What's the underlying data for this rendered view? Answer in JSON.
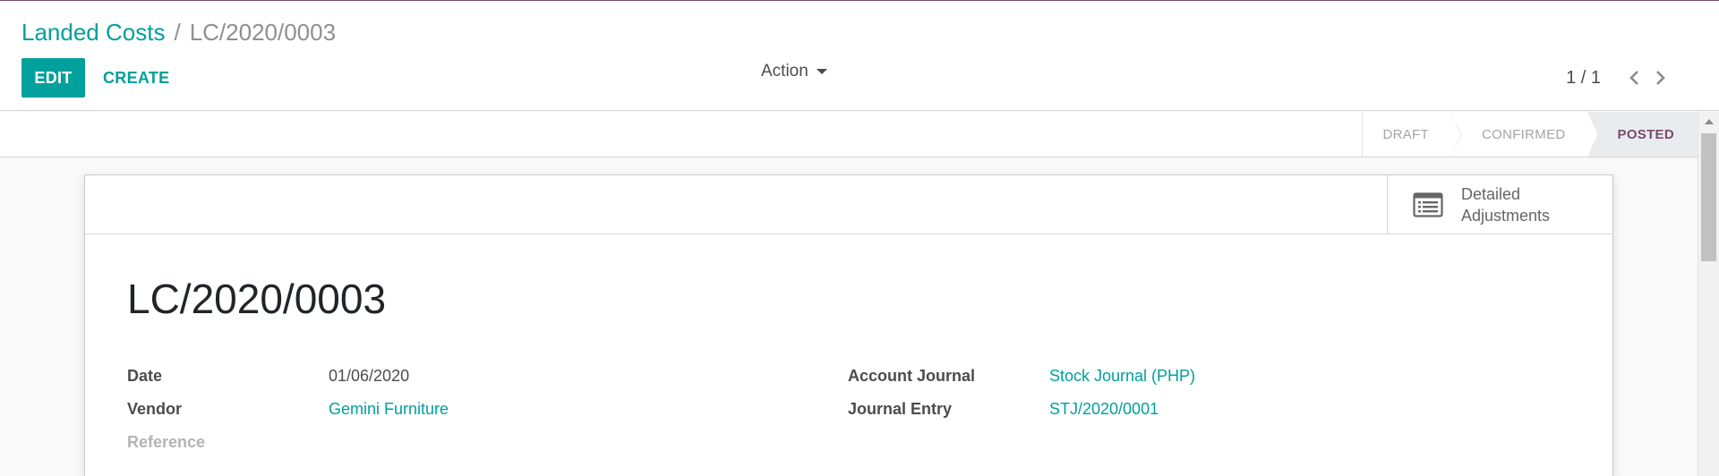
{
  "breadcrumb": {
    "parent": "Landed Costs",
    "separator": "/",
    "current": "LC/2020/0003"
  },
  "toolbar": {
    "edit_label": "EDIT",
    "create_label": "CREATE",
    "action_label": "Action"
  },
  "pager": {
    "value": "1 / 1"
  },
  "statusbar": {
    "stages": [
      {
        "label": "DRAFT",
        "active": false
      },
      {
        "label": "CONFIRMED",
        "active": false
      },
      {
        "label": "POSTED",
        "active": true
      }
    ]
  },
  "smart_button": {
    "line1": "Detailed",
    "line2": "Adjustments",
    "icon": "list-icon"
  },
  "record": {
    "title": "LC/2020/0003"
  },
  "fields": {
    "date": {
      "label": "Date",
      "value": "01/06/2020"
    },
    "vendor": {
      "label": "Vendor",
      "value": "Gemini Furniture"
    },
    "reference": {
      "label": "Reference",
      "value": ""
    },
    "account_journal": {
      "label": "Account Journal",
      "value": "Stock Journal (PHP)"
    },
    "journal_entry": {
      "label": "Journal Entry",
      "value": "STJ/2020/0001"
    }
  },
  "colors": {
    "primary": "#00a09d",
    "active_stage": "#7c4a6c",
    "text": "#4c4c4c"
  }
}
